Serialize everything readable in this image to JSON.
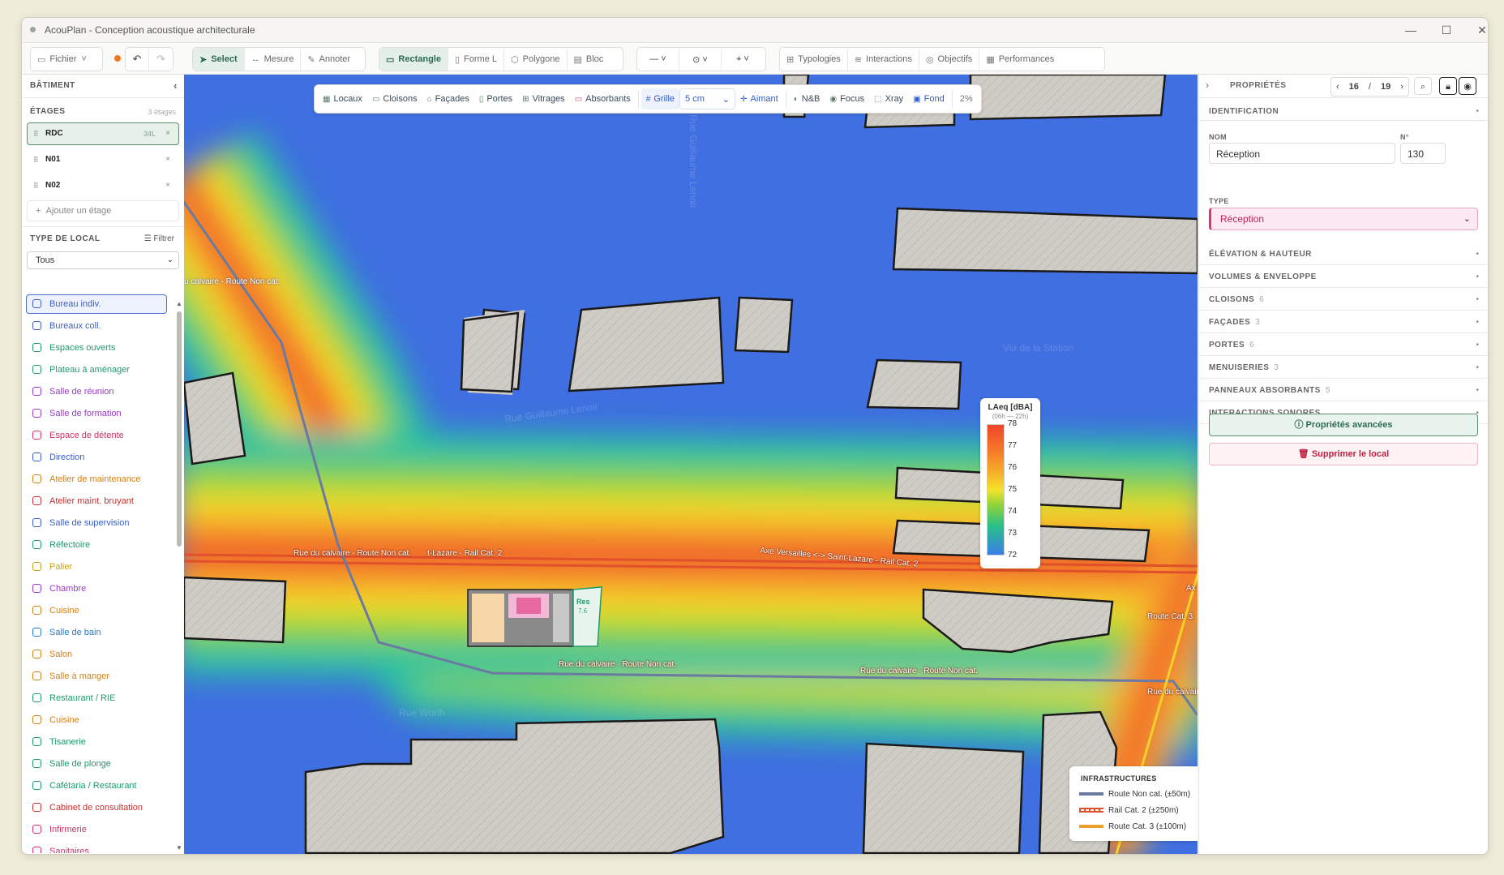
{
  "window": {
    "title": "AcouPlan - Conception acoustique architecturale",
    "controls": [
      "—",
      "☐",
      "✕"
    ]
  },
  "toolbar": {
    "file": "Fichier",
    "tools": [
      "Select",
      "Mesure",
      "Annoter"
    ],
    "shapes": [
      "Rectangle",
      "Forme L",
      "Polygone",
      "Bloc"
    ],
    "views": [
      "Typologies",
      "Interactions",
      "Objectifs",
      "Performances"
    ]
  },
  "sidebar": {
    "title": "BÂTIMENT",
    "floors_label": "ÉTAGES",
    "floors_count": "3 étages",
    "floors": [
      {
        "name": "RDC",
        "area": "34L",
        "selected": true
      },
      {
        "name": "N01",
        "area": "",
        "selected": false
      },
      {
        "name": "N02",
        "area": "",
        "selected": false
      }
    ],
    "add_floor": "Ajouter un étage",
    "room_type_label": "TYPE DE LOCAL",
    "filter_label": "Filtrer",
    "select_value": "Tous",
    "room_types": [
      {
        "label": "Bureau indiv.",
        "color": "#3a5ec8",
        "selected": true
      },
      {
        "label": "Bureaux coll.",
        "color": "#3a5ec8"
      },
      {
        "label": "Espaces ouverts",
        "color": "#1f9a6a"
      },
      {
        "label": "Plateau à aménager",
        "color": "#1f9a6a"
      },
      {
        "label": "Salle de réunion",
        "color": "#9a3ac8"
      },
      {
        "label": "Salle de formation",
        "color": "#9a3ac8"
      },
      {
        "label": "Espace de détente",
        "color": "#d0306a"
      },
      {
        "label": "Direction",
        "color": "#3a5ec8"
      },
      {
        "label": "Atelier de maintenance",
        "color": "#d0801a"
      },
      {
        "label": "Atelier maint. bruyant",
        "color": "#c83030"
      },
      {
        "label": "Salle de supervision",
        "color": "#3a5ec8"
      },
      {
        "label": "Réfectoire",
        "color": "#1f9a6a"
      },
      {
        "label": "Palier",
        "color": "#c8a01a"
      },
      {
        "label": "Chambre",
        "color": "#9a3ac8"
      },
      {
        "label": "Cuisine",
        "color": "#d0801a"
      },
      {
        "label": "Salle de bain",
        "color": "#2a7ac8"
      },
      {
        "label": "Salon",
        "color": "#d0801a"
      },
      {
        "label": "Salle à manger",
        "color": "#d0801a"
      },
      {
        "label": "Restaurant / RIE",
        "color": "#1f9a6a"
      },
      {
        "label": "Cuisine",
        "color": "#d0801a"
      },
      {
        "label": "Tisanerie",
        "color": "#1f9a6a"
      },
      {
        "label": "Salle de plonge",
        "color": "#1f9a6a"
      },
      {
        "label": "Cafétaria / Restaurant",
        "color": "#1f9a6a"
      },
      {
        "label": "Cabinet de consultation",
        "color": "#c83030"
      },
      {
        "label": "Infirmerie",
        "color": "#d0306a"
      },
      {
        "label": "Sanitaires",
        "color": "#d0306a"
      }
    ]
  },
  "maptools": {
    "layers": [
      "Locaux",
      "Cloisons",
      "Façades",
      "Portes",
      "Vitrages",
      "Absorbants"
    ],
    "grid": "Grille",
    "grid_size": "5 cm",
    "snap": "Aimant",
    "nb": "N&B",
    "focus": "Focus",
    "xray": "Xray",
    "bg": "Fond",
    "opacity": "2%"
  },
  "legend": {
    "title": "LAeq [dBA]",
    "subtitle": "(06h — 22h)",
    "ticks": [
      "78",
      "77",
      "76",
      "75",
      "74",
      "73",
      "72"
    ]
  },
  "infra": {
    "title": "INFRASTRUCTURES",
    "items": [
      {
        "label": "Route Non cat. (±50m)",
        "color": "#6a7aa0"
      },
      {
        "label": "Rail Cat. 2 (±250m)",
        "color": "#e05a2a"
      },
      {
        "label": "Route Cat. 3 (±100m)",
        "color": "#e8a02a"
      }
    ]
  },
  "map_labels": {
    "l1": "u calvaire - Route Non cat.",
    "l2": "Rue du calvaire - Route Non cat.",
    "l3": "t-Lazare - Rail Cat. 2",
    "l4": "Axe Versailles <-> Saint-Lazare - Rail Cat. 2",
    "l5": "Route Cat. 3",
    "l6": "Rue du calvaire - Route Non cat.",
    "l7": "Rue du calvaire - Route Non cat.",
    "l8": "Rue du calvaire - R",
    "l9": "Ax",
    "s1": "Rue Guillaume Lenoir",
    "s2": "Rue Guillaume Lenoir",
    "s3": "Rue Worth",
    "s4": "Via de la Station",
    "room_label": "Res",
    "room_area": "7.6"
  },
  "panel": {
    "title": "PROPRIÉTÉS",
    "pager_current": "16",
    "pager_sep": "/",
    "pager_total": "19",
    "identification": "IDENTIFICATION",
    "name_label": "NOM",
    "name_value": "Réception",
    "num_label": "N°",
    "num_value": "130",
    "type_label": "TYPE",
    "type_value": "Réception",
    "sections": [
      {
        "label": "ÉLÉVATION & HAUTEUR",
        "count": ""
      },
      {
        "label": "VOLUMES & ENVELOPPE",
        "count": ""
      },
      {
        "label": "CLOISONS",
        "count": "6"
      },
      {
        "label": "FAÇADES",
        "count": "3"
      },
      {
        "label": "PORTES",
        "count": "6"
      },
      {
        "label": "MENUISERIES",
        "count": "3"
      },
      {
        "label": "PANNEAUX ABSORBANTS",
        "count": "5"
      },
      {
        "label": "INTERACTIONS SONORES",
        "count": ""
      }
    ],
    "advanced_button": "Propriétés avancées",
    "delete_button": "Supprimer le local"
  }
}
